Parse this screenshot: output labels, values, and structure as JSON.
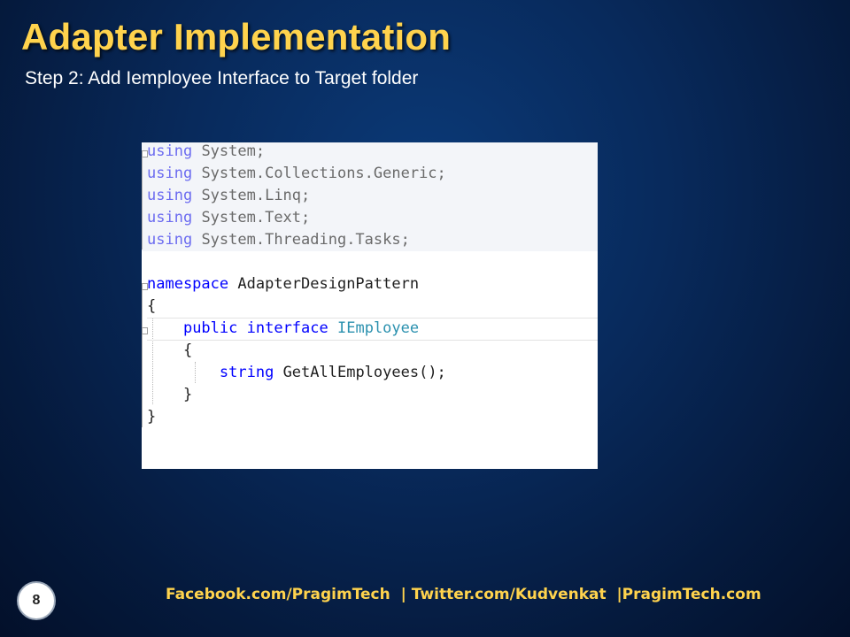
{
  "slide": {
    "title": "Adapter Implementation",
    "subtitle": "Step 2: Add Iemployee Interface to Target folder",
    "page_number": "8",
    "footer": "Facebook.com/PragimTech  | Twitter.com/Kudvenkat  |PragimTech.com"
  },
  "code": {
    "using_keyword": "using",
    "usings": [
      "System;",
      "System.Collections.Generic;",
      "System.Linq;",
      "System.Text;",
      "System.Threading.Tasks;"
    ],
    "namespace_keyword": "namespace",
    "namespace_name": "AdapterDesignPattern",
    "open_brace": "{",
    "close_brace": "}",
    "public_keyword": "public",
    "interface_keyword": "interface",
    "interface_name": "IEmployee",
    "return_type": "string",
    "method_signature": "GetAllEmployees();"
  },
  "colors": {
    "title": "#ffd34d",
    "background": "#082a5c",
    "keyword": "#0000ff",
    "type_name": "#2b91af"
  }
}
